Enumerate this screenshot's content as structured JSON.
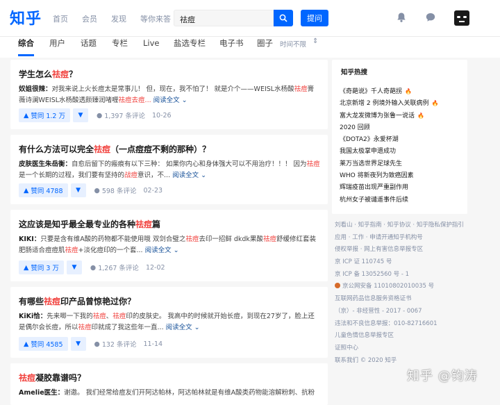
{
  "header": {
    "logo": "知乎",
    "nav": [
      "首页",
      "会员",
      "发现",
      "等你来答"
    ],
    "search_value": "祛痘",
    "ask_label": "提问"
  },
  "subnav": {
    "tabs": [
      "综合",
      "用户",
      "话题",
      "专栏",
      "Live",
      "盐选专栏",
      "电子书",
      "圈子"
    ],
    "active": "综合",
    "time_filter": "时间不限"
  },
  "results": [
    {
      "title": [
        "学生怎么",
        "祛痘",
        "？"
      ],
      "excerpt": [
        "奴姐很辣：",
        "对我来说上火长痘太是常事儿！ 但，现在，我不怕了！ 就是介个——WEISL水杨酸",
        "祛痘",
        "膏 薇诗澜WEISL水杨酸透颜臻润啫喱",
        "祛痘",
        "去痘...",
        "阅读全文"
      ],
      "vote": "赞同 1.2 万",
      "comments": "1,397 条评论",
      "date": "10-26"
    },
    {
      "title": [
        "有什么方法可以完全",
        "祛痘",
        "（一点痘痘不剩的那种）？"
      ],
      "excerpt": [
        "皮肤医生朱岳衡：",
        "自愈后留下的瘢痕有以下三种： 如果你内心和身体强大可以不用治疗！！！ 因为",
        "祛痘",
        "是一个长期的过程，我们要有坚持的",
        "战痘",
        "意识，不...",
        "阅读全文"
      ],
      "vote": "赞同 4788",
      "comments": "598 条评论",
      "date": "02-23"
    },
    {
      "title": [
        "这应该是知乎最全最专业的各种",
        "祛痘",
        "篇"
      ],
      "excerpt": [
        "KIKI：",
        "只要是含有维A酸的药物都不能使用哦 双剑合璧之",
        "祛痘",
        "去印一招鲜 dkdk果酸",
        "祛痘",
        "舒缓修红套装 肥肠适合痘痘肌",
        "祛痘",
        "+淡化痘印的一个套...",
        "阅读全文"
      ],
      "vote": "赞同 3 万",
      "comments": "1,267 条评论",
      "date": "12-02"
    },
    {
      "title": [
        "有哪些",
        "祛痘",
        "印产品曾惊艳过你？"
      ],
      "excerpt": [
        "KiKi恰：",
        "先来唧一下我的",
        "祛痘",
        "、",
        "祛痘",
        "印的皮肤史。 我高中的时候就开始长痘，到现在27岁了，脸上还是偶尔会长痘，所以",
        "祛痘",
        "印就成了我这些年一直...",
        "阅读全文"
      ],
      "vote": "赞同 4585",
      "comments": "132 条评论",
      "date": "11-14"
    },
    {
      "title": [
        "祛痘",
        "凝胶靠谱吗？"
      ],
      "excerpt": [
        "Amelie医生：",
        "谢邀。 我们经常给痘友们开阿达帕林，阿达帕林就是有维A酸类药物能溶解粉刺、抗粉刺生"
      ]
    }
  ],
  "hot": {
    "title": "知乎热搜",
    "items": [
      {
        "text": "《奇葩说》千人奇葩拐",
        "hot": true
      },
      {
        "text": "北京新增 2 例境外输入关联病例",
        "hot": true
      },
      {
        "text": "富大龙发微博为张鲁一说话",
        "hot": true
      },
      {
        "text": "2020 回顾",
        "hot": false
      },
      {
        "text": "《DOTA2》永爱杯湖",
        "hot": false
      },
      {
        "text": "我国太极掌申遗成功",
        "hot": false
      },
      {
        "text": "莱万当选世界足球先生",
        "hot": false
      },
      {
        "text": "WHO 将新夜列为致癌因素",
        "hot": false
      },
      {
        "text": "辉瑞疫苗出现严重副作用",
        "hot": false
      },
      {
        "text": "杭州女子被谴遥事件后续",
        "hot": false
      }
    ]
  },
  "footer": [
    "刘看山 · 知乎指南 · 知乎协议 · 知乎隐私保护指引",
    "应用 · 工作 · 申请开通知乎机构号",
    "侵权举报 · 网上有害信息举报专区",
    "京 ICP 证 110745 号",
    "京 ICP 备 13052560 号 - 1",
    "京公网安备 11010802010035 号",
    "互联网药品信息服务资格证书",
    "（京）- 非经营性 - 2017 - 0067",
    "违法和不良信息举报：010-82716601",
    "儿童色情信息举报专区",
    "证照中心",
    "联系我们 © 2020 知乎"
  ],
  "watermark": "知乎 @钧涛",
  "colors": {
    "brand": "#0066ff",
    "highlight": "#f1403c",
    "muted": "#8590a6"
  }
}
